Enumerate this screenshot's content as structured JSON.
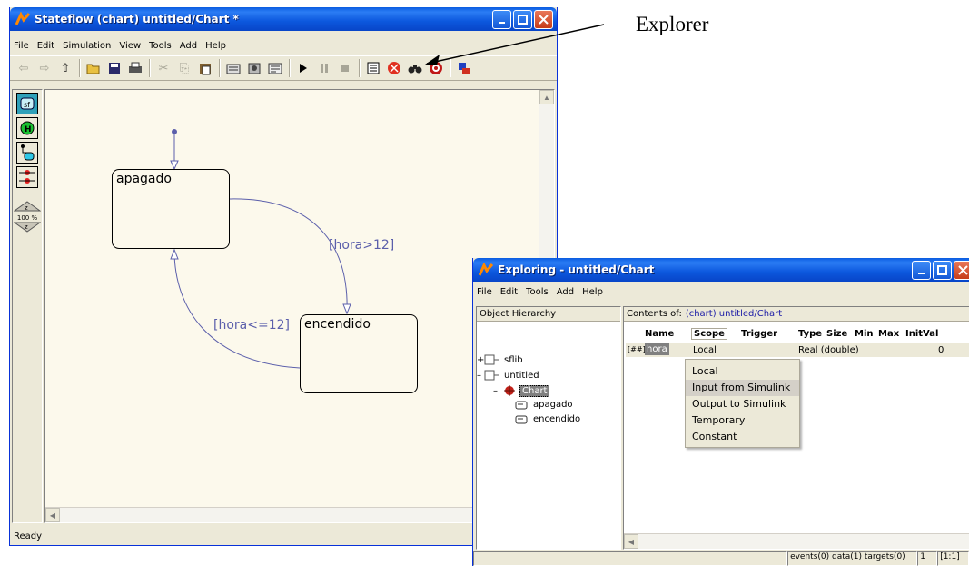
{
  "stateflow": {
    "title": "Stateflow (chart) untitled/Chart *",
    "menu": [
      "File",
      "Edit",
      "Simulation",
      "View",
      "Tools",
      "Add",
      "Help"
    ],
    "status": "Ready",
    "zoom": "100 %",
    "states": {
      "off": "apagado",
      "on": "encendido"
    },
    "transitions": {
      "off_to_on": "[hora>12]",
      "on_to_off": "[hora<=12]"
    }
  },
  "annotation": {
    "label": "Explorer"
  },
  "explorer": {
    "title": "Exploring - untitled/Chart",
    "menu": [
      "File",
      "Edit",
      "Tools",
      "Add",
      "Help"
    ],
    "hierarchy_header": "Object Hierarchy",
    "contents_prefix": "Contents of:",
    "contents_path": "(chart) untitled/Chart",
    "tree": {
      "sflib": "sflib",
      "untitled": "untitled",
      "chart": "Chart",
      "apagado": "apagado",
      "encendido": "encendido",
      "expand_plus": "+",
      "collapse_minus": "–"
    },
    "columns": {
      "name": "Name",
      "scope": "Scope",
      "trigger": "Trigger",
      "type": "Type",
      "size": "Size",
      "min": "Min",
      "max": "Max",
      "initval": "InitVal"
    },
    "row": {
      "icon": "[##]",
      "name": "hora",
      "scope": "Local",
      "type": "Real (double)",
      "initval": "0"
    },
    "scope_options": [
      "Local",
      "Input from Simulink",
      "Output to Simulink",
      "Temporary",
      "Constant"
    ],
    "highlighted_option": "Input from Simulink",
    "status": {
      "counts": "events(0) data(1) targets(0)",
      "index": "1",
      "range": "[1:1]"
    }
  },
  "colors": {
    "titlebar": "#0c57dd",
    "chart_background": "#fcf9ec",
    "transition": "#5b5fab",
    "selection": "#808080"
  }
}
